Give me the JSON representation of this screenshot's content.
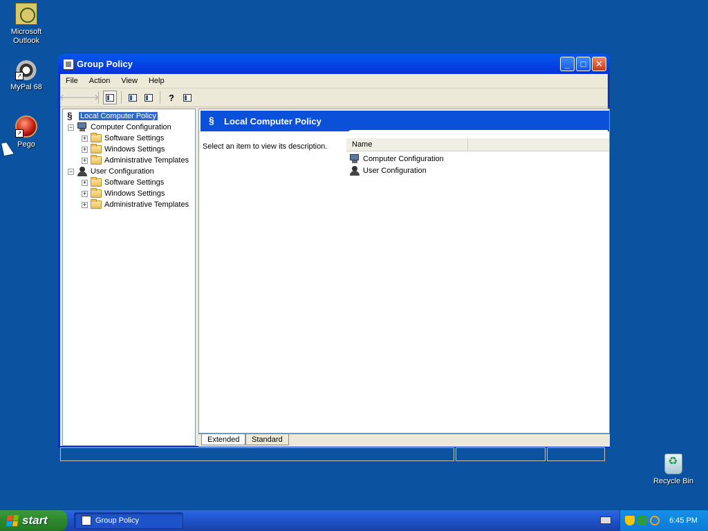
{
  "desktop": {
    "icons": [
      {
        "label": "Microsoft Outlook",
        "icon": "outlook-icon"
      },
      {
        "label": "MyPal 68",
        "icon": "mypal-icon"
      },
      {
        "label": "Pego",
        "icon": "pego-icon"
      },
      {
        "label": "Recycle Bin",
        "icon": "recycle-bin-icon"
      }
    ]
  },
  "window": {
    "title": "Group Policy",
    "menu": [
      "File",
      "Action",
      "View",
      "Help"
    ],
    "tree": {
      "root": "Local Computer Policy",
      "computer": {
        "label": "Computer Configuration",
        "children": [
          "Software Settings",
          "Windows Settings",
          "Administrative Templates"
        ]
      },
      "user": {
        "label": "User Configuration",
        "children": [
          "Software Settings",
          "Windows Settings",
          "Administrative Templates"
        ]
      }
    },
    "result": {
      "banner_title": "Local Computer Policy",
      "description": "Select an item to view its description.",
      "list_header": "Name",
      "items": [
        "Computer Configuration",
        "User Configuration"
      ]
    },
    "tabs": [
      "Extended",
      "Standard"
    ]
  },
  "taskbar": {
    "start_label": "start",
    "task_label": "Group Policy",
    "clock": "6:45 PM"
  },
  "colors": {
    "desktop": "#0b52a0",
    "titlebar": "#0831d9",
    "selection": "#316ac5",
    "start": "#2f8b2f"
  }
}
